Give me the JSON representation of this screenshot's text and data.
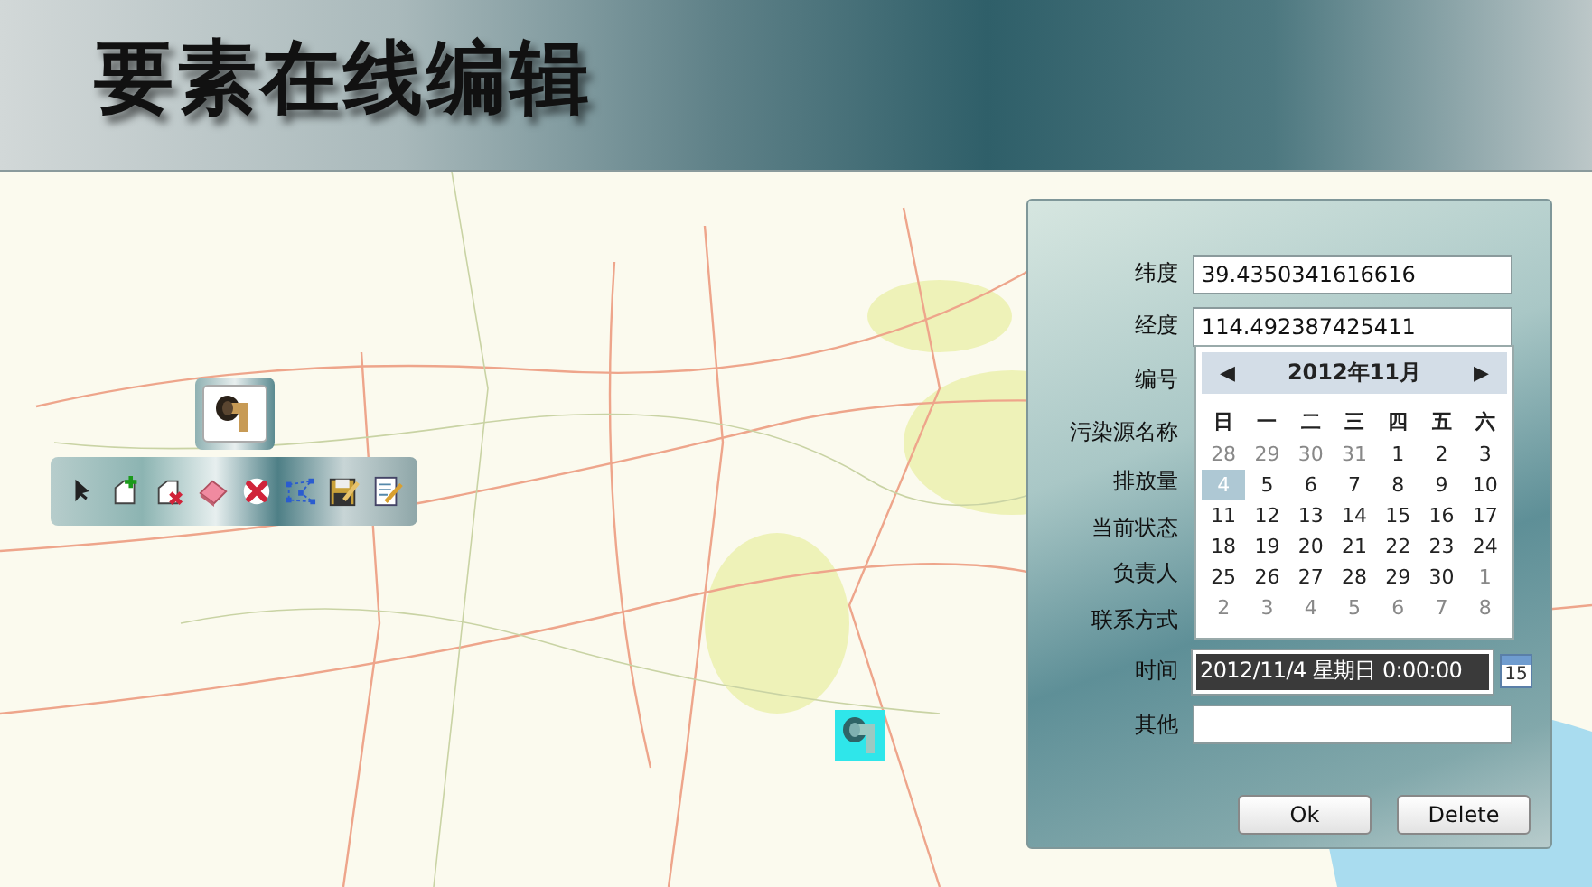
{
  "header": {
    "title": "要素在线编辑"
  },
  "form": {
    "fields": [
      {
        "label": "纬度",
        "kind": "text",
        "value": "39.4350341616616"
      },
      {
        "label": "经度",
        "kind": "text",
        "value": "114.492387425411"
      },
      {
        "label": "编号",
        "kind": "hidden"
      },
      {
        "label": "污染源名称",
        "kind": "hidden"
      },
      {
        "label": "排放量",
        "kind": "hidden"
      },
      {
        "label": "当前状态",
        "kind": "hidden"
      },
      {
        "label": "负责人",
        "kind": "hidden"
      },
      {
        "label": "联系方式",
        "kind": "hidden"
      },
      {
        "label": "时间",
        "kind": "date",
        "value": "2012/11/4 星期日 0:00:00",
        "button_text": "15"
      },
      {
        "label": "其他",
        "kind": "text"
      }
    ],
    "buttons": [
      "Ok",
      "Delete"
    ]
  },
  "calendar": {
    "prev": "◀",
    "next": "▶",
    "month": "2012年11月",
    "weekdays": [
      "日",
      "一",
      "二",
      "三",
      "四",
      "五",
      "六"
    ],
    "days": [
      {
        "day": "28",
        "other_month": true,
        "selected": false
      },
      {
        "day": "29",
        "other_month": true,
        "selected": false
      },
      {
        "day": "30",
        "other_month": true,
        "selected": false
      },
      {
        "day": "31",
        "other_month": true,
        "selected": false
      },
      {
        "day": "1",
        "other_month": false,
        "selected": false
      },
      {
        "day": "2",
        "other_month": false,
        "selected": false
      },
      {
        "day": "3",
        "other_month": false,
        "selected": false
      },
      {
        "day": "4",
        "other_month": false,
        "selected": true
      },
      {
        "day": "5",
        "other_month": false,
        "selected": false
      },
      {
        "day": "6",
        "other_month": false,
        "selected": false
      },
      {
        "day": "7",
        "other_month": false,
        "selected": false
      },
      {
        "day": "8",
        "other_month": false,
        "selected": false
      },
      {
        "day": "9",
        "other_month": false,
        "selected": false
      },
      {
        "day": "10",
        "other_month": false,
        "selected": false
      },
      {
        "day": "11",
        "other_month": false,
        "selected": false
      },
      {
        "day": "12",
        "other_month": false,
        "selected": false
      },
      {
        "day": "13",
        "other_month": false,
        "selected": false
      },
      {
        "day": "14",
        "other_month": false,
        "selected": false
      },
      {
        "day": "15",
        "other_month": false,
        "selected": false
      },
      {
        "day": "16",
        "other_month": false,
        "selected": false
      },
      {
        "day": "17",
        "other_month": false,
        "selected": false
      },
      {
        "day": "18",
        "other_month": false,
        "selected": false
      },
      {
        "day": "19",
        "other_month": false,
        "selected": false
      },
      {
        "day": "20",
        "other_month": false,
        "selected": false
      },
      {
        "day": "21",
        "other_month": false,
        "selected": false
      },
      {
        "day": "22",
        "other_month": false,
        "selected": false
      },
      {
        "day": "23",
        "other_month": false,
        "selected": false
      },
      {
        "day": "24",
        "other_month": false,
        "selected": false
      },
      {
        "day": "25",
        "other_month": false,
        "selected": false
      },
      {
        "day": "26",
        "other_month": false,
        "selected": false
      },
      {
        "day": "27",
        "other_month": false,
        "selected": false
      },
      {
        "day": "28",
        "other_month": false,
        "selected": false
      },
      {
        "day": "29",
        "other_month": false,
        "selected": false
      },
      {
        "day": "30",
        "other_month": false,
        "selected": false
      },
      {
        "day": "1",
        "other_month": true,
        "selected": false
      },
      {
        "day": "2",
        "other_month": true,
        "selected": false
      },
      {
        "day": "3",
        "other_month": true,
        "selected": false
      },
      {
        "day": "4",
        "other_month": true,
        "selected": false
      },
      {
        "day": "5",
        "other_month": true,
        "selected": false
      },
      {
        "day": "6",
        "other_month": true,
        "selected": false
      },
      {
        "day": "7",
        "other_month": true,
        "selected": false
      },
      {
        "day": "8",
        "other_month": true,
        "selected": false
      }
    ]
  }
}
